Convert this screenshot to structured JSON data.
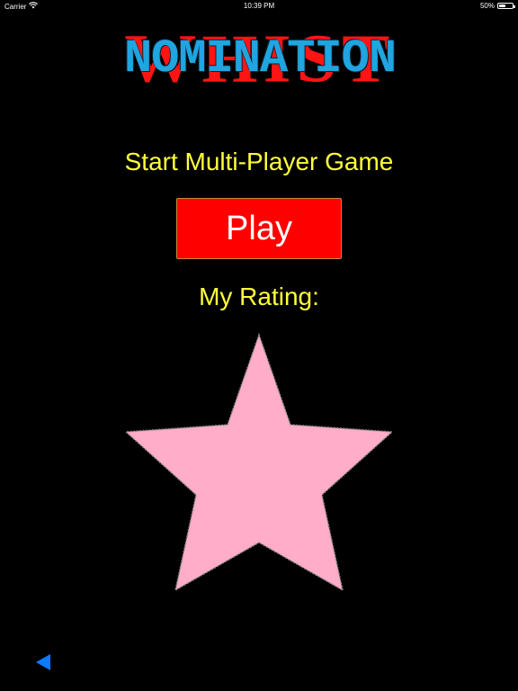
{
  "status_bar": {
    "carrier": "Carrier",
    "time": "10:39 PM",
    "battery": "50%",
    "battery_level": 0.5,
    "wifi_icon": "wifi-icon",
    "battery_icon": "battery-icon"
  },
  "logo": {
    "back_word": "WHIST",
    "front_word": "NOMINATION"
  },
  "main": {
    "subtitle": "Start Multi-Player Game",
    "play_label": "Play",
    "rating_label": "My Rating:",
    "rating_star_icon": "star-icon",
    "back_icon": "back-triangle-icon"
  },
  "colors": {
    "background": "#000000",
    "accent_yellow": "#ffff3a",
    "button_red": "#ff0000",
    "logo_red": "#ff1414",
    "logo_blue": "#1fa5e0",
    "star_pink": "#ffadc8",
    "back_blue": "#0a7bff"
  }
}
